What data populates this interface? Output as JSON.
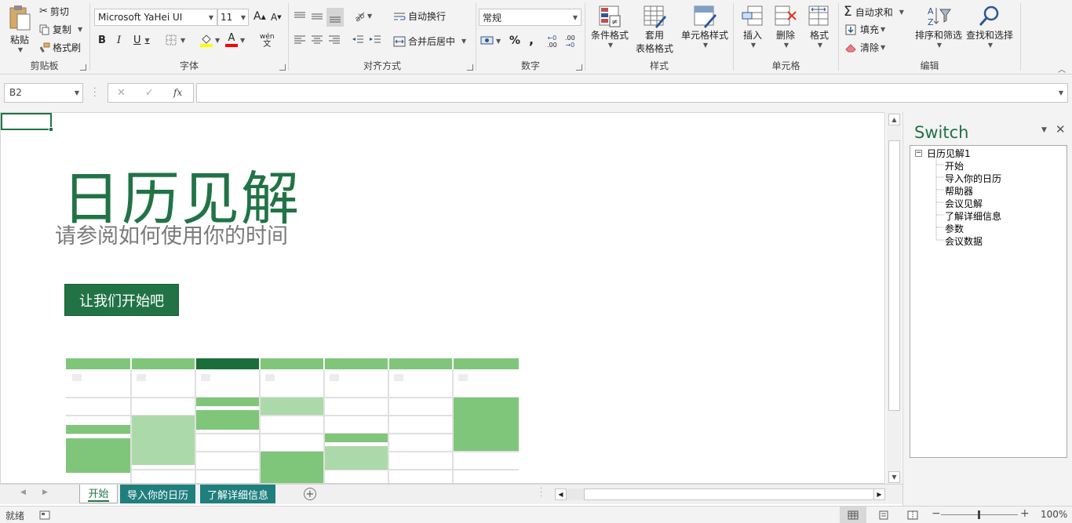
{
  "ribbon": {
    "clipboard": {
      "paste": "粘贴",
      "cut": "剪切",
      "copy": "复制",
      "format_painter": "格式刷",
      "label": "剪贴板"
    },
    "font": {
      "font_name": "Microsoft YaHei UI",
      "font_size": "11",
      "bold": "B",
      "italic": "I",
      "underline": "U",
      "grow": "A",
      "shrink": "A",
      "font_color_glyph": "A",
      "phonetic": "wén",
      "label": "字体"
    },
    "alignment": {
      "wrap_text": "自动换行",
      "merge_center": "合并后居中",
      "label": "对齐方式"
    },
    "number": {
      "format": "常规",
      "percent": "%",
      "comma": ",",
      "inc_decimal": ".00",
      "dec_decimal": ".0",
      "label": "数字"
    },
    "styles": {
      "conditional_formatting": "条件格式",
      "format_as_table_1": "套用",
      "format_as_table_2": "表格格式",
      "cell_styles": "单元格样式",
      "label": "样式"
    },
    "cells": {
      "insert": "插入",
      "delete": "删除",
      "format": "格式",
      "label": "单元格"
    },
    "editing": {
      "autosum": "自动求和",
      "fill": "填充",
      "clear": "清除",
      "sort_filter": "排序和筛选",
      "find_select": "查找和选择",
      "label": "编辑"
    }
  },
  "formula_bar": {
    "name_box": "B2",
    "fx": "fx",
    "cancel": "✕",
    "enter": "✓",
    "formula": ""
  },
  "content": {
    "title": "日历见解",
    "subtitle": "请参阅如何使用你的时间",
    "start_button": "让我们开始吧"
  },
  "switch_pane": {
    "title": "Switch",
    "root": "日历见解1",
    "items": [
      "开始",
      "导入你的日历",
      "帮助器",
      "会议见解",
      "了解详细信息",
      "参数",
      "会议数据"
    ]
  },
  "sheet_tabs": {
    "tabs": [
      "开始",
      "导入你的日历",
      "了解详细信息"
    ],
    "active": "开始"
  },
  "status": {
    "ready": "就绪",
    "zoom": "100%"
  },
  "colors": {
    "accent": "#217346",
    "tab_teal": "#1f7f7c",
    "cal_header": "#7fc67a",
    "cal_header_active": "#1a6e3a",
    "cal_light": "#acd9a9"
  }
}
